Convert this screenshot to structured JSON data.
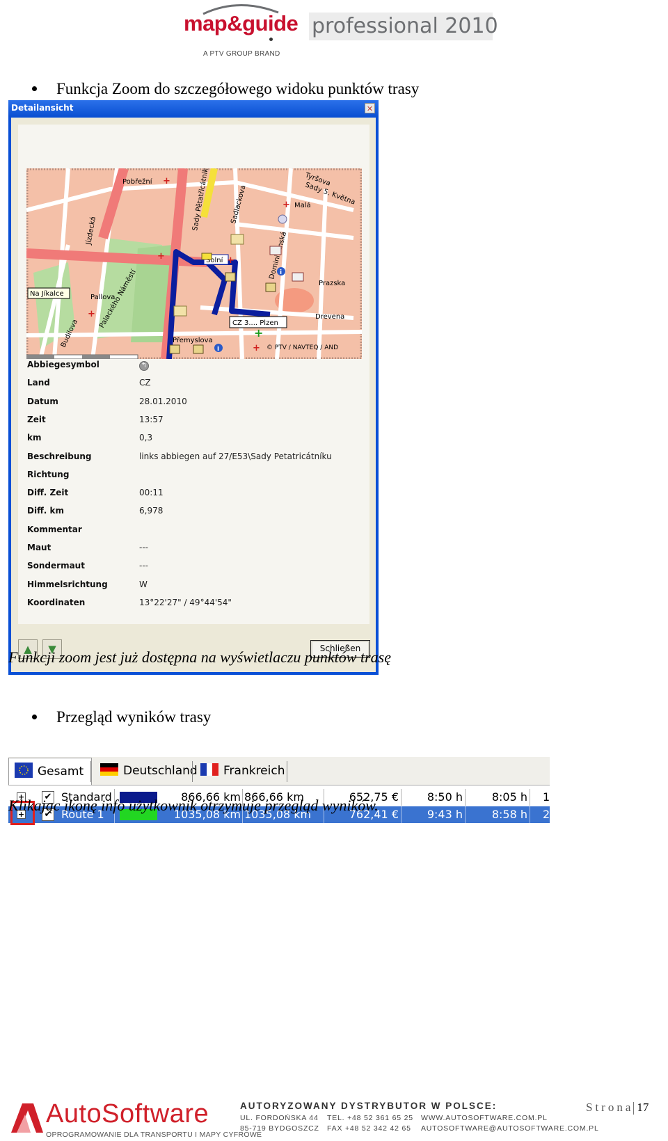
{
  "header": {
    "brand": "map&guide",
    "product": "professional 2010",
    "tagline": "A PTV GROUP BRAND"
  },
  "section1": {
    "bullet": "Funkcja Zoom do szczegółowego widoku punktów trasy",
    "caption": "Funkcji zoom jest już dostępna na wyświetlaczu punktów trasę"
  },
  "dialog": {
    "title": "Detailansicht",
    "close_glyph": "✕",
    "map": {
      "labels": [
        "Pobřežní",
        "Tyršova",
        "Sady 5. Května",
        "Malá",
        "Jízdecká",
        "Sadlackova",
        "Sady Pětatřicátníků",
        "Dominikánská",
        "Solní",
        "Prazska",
        "Na Jíkalce",
        "Pallova",
        "Palackého Náměstí",
        "Budilova",
        "Drevena",
        "CZ 3.... Plzen",
        "Přemyslova",
        "© PTV / NAVTEQ / AND"
      ],
      "accent_route": "#0b1e9e",
      "road_primary": "#f07a78",
      "background": "#f4c0a8"
    },
    "properties": [
      {
        "label": "Abbiegesymbol",
        "value": "",
        "icon": "turn-arrow-icon"
      },
      {
        "label": "Land",
        "value": "CZ"
      },
      {
        "label": "Datum",
        "value": "28.01.2010"
      },
      {
        "label": "Zeit",
        "value": "13:57"
      },
      {
        "label": "km",
        "value": "0,3"
      },
      {
        "label": "Beschreibung",
        "value": "links abbiegen auf 27/E53\\Sady Petatricátníku"
      },
      {
        "label": "Richtung",
        "value": ""
      },
      {
        "label": "Diff. Zeit",
        "value": "00:11"
      },
      {
        "label": "Diff. km",
        "value": "6,978"
      },
      {
        "label": "Kommentar",
        "value": ""
      },
      {
        "label": "Maut",
        "value": "---"
      },
      {
        "label": "Sondermaut",
        "value": "---"
      },
      {
        "label": "Himmelsrichtung",
        "value": "W"
      },
      {
        "label": "Koordinaten",
        "value": "13°22'27\" / 49°44'54\""
      }
    ],
    "nav_prev_glyph": "▲",
    "nav_next_glyph": "▼",
    "close_button": "Schließen"
  },
  "section2": {
    "bullet": "Przegląd wyników trasy",
    "caption": "Klikając ikonę info użytkownik otrzymuje przegląd wyników."
  },
  "results": {
    "tabs": [
      {
        "label": "Gesamt",
        "flag": "eu-flag-icon"
      },
      {
        "label": "Deutschland",
        "flag": "de-flag-icon"
      },
      {
        "label": "Frankreich",
        "flag": "fr-flag-icon"
      }
    ],
    "rows": [
      {
        "expand": "+",
        "checked": "✔",
        "name": "Standard",
        "color": "#0a1a8c",
        "dist1": "866,66 km",
        "dist2": "866,66 km",
        "cost": "652,75 €",
        "time1": "8:50 h",
        "time2": "8:05 h",
        "extra": "1"
      },
      {
        "expand": "+",
        "checked": "✔",
        "name": "Route 1",
        "color": "#22d622",
        "dist1": "1035,08 km",
        "dist2": "1035,08 km",
        "cost": "762,41 €",
        "time1": "9:43 h",
        "time2": "8:58 h",
        "extra": "2"
      }
    ]
  },
  "footer": {
    "company": "AutoSoftware",
    "company_sub": "OPROGRAMOWANIE DLA TRANSPORTU I MAPY CYFROWE",
    "distributor": "AUTORYZOWANY DYSTRYBUTOR W POLSCE:",
    "street": "UL. FORDOŃSKA 44",
    "city": "85-719 BYDGOSZCZ",
    "tel": "TEL.  +48 52 361 65 25",
    "fax": "FAX  +48 52 342 42 65",
    "web": "WWW.AUTOSOFTWARE.COM.PL",
    "email": "AUTOSOFTWARE@AUTOSOFTWARE.COM.PL",
    "page_label": "Strona",
    "page_number": "17"
  }
}
